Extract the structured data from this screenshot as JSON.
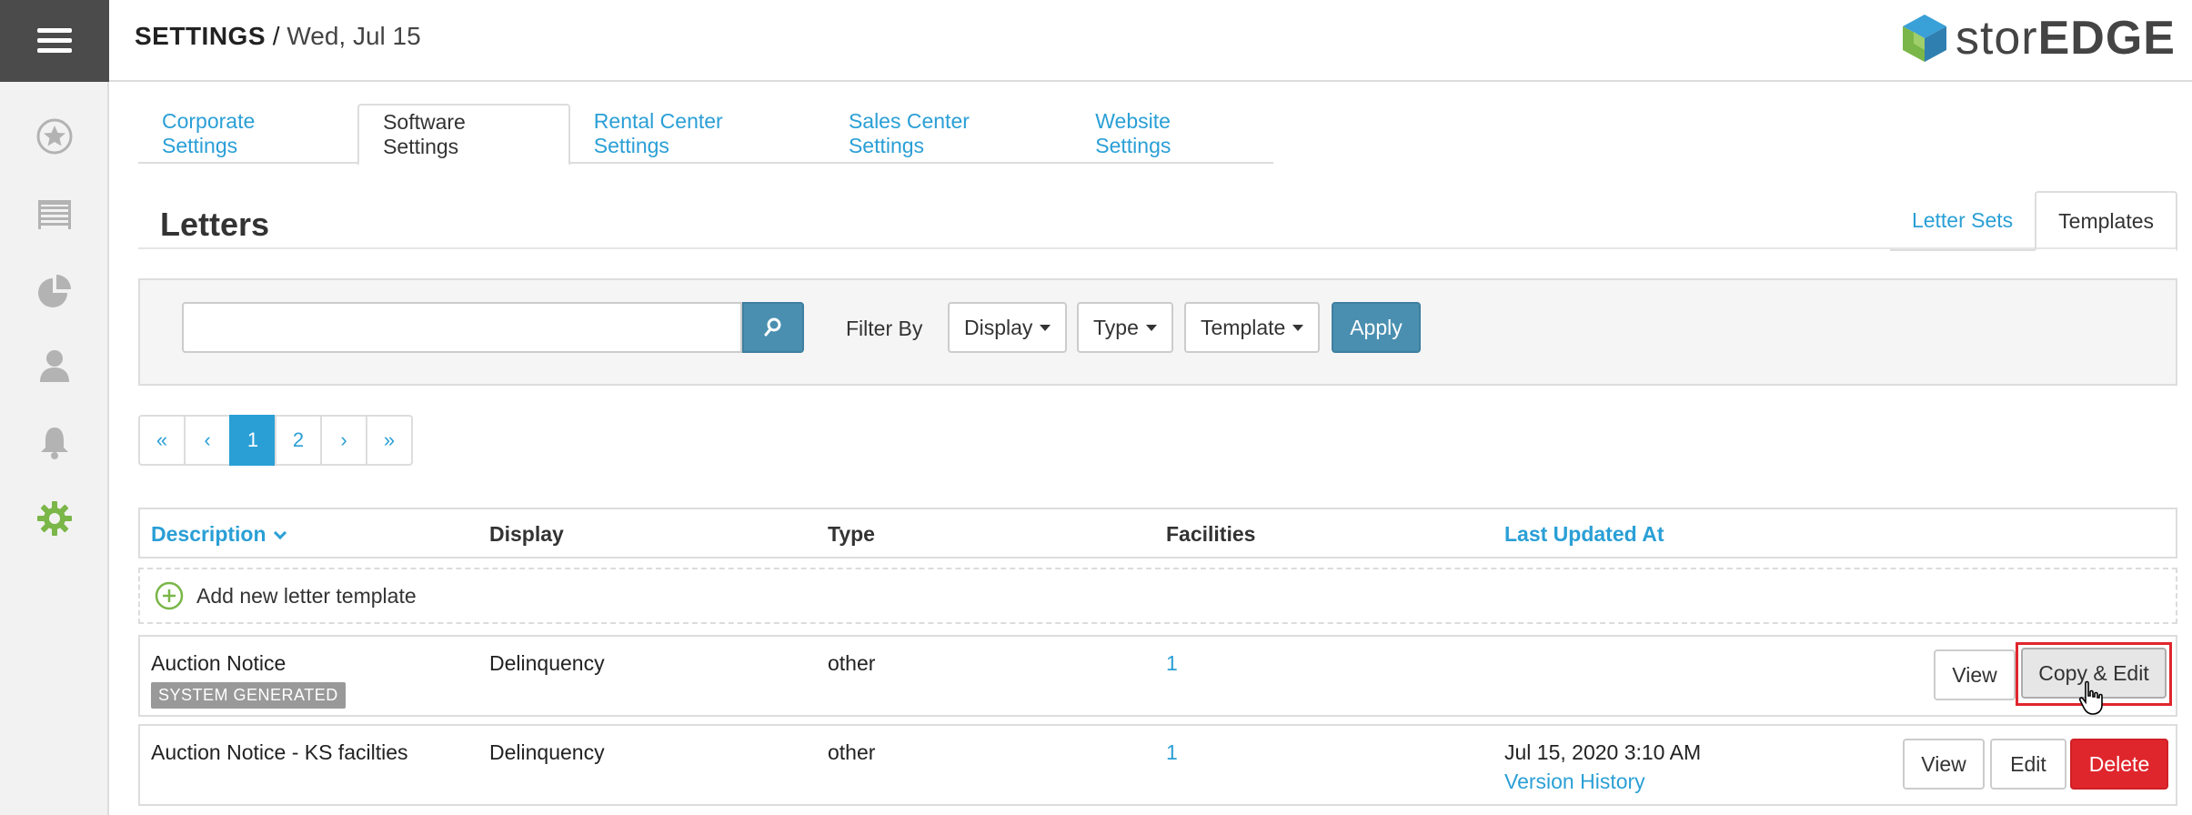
{
  "header": {
    "section": "SETTINGS",
    "separator": " / ",
    "date": "Wed, Jul 15",
    "logo_light": "stor",
    "logo_bold": "EDGE"
  },
  "rail": {
    "icons": [
      "star-icon",
      "storage-icon",
      "pie-chart-icon",
      "user-icon",
      "bell-icon",
      "gear-icon"
    ],
    "active_color": "#7ab648",
    "icon_color": "#b3b3b3"
  },
  "main_tabs": [
    {
      "label": "Corporate Settings",
      "active": false
    },
    {
      "label": "Software Settings",
      "active": true
    },
    {
      "label": "Rental Center Settings",
      "active": false
    },
    {
      "label": "Sales Center Settings",
      "active": false
    },
    {
      "label": "Website Settings",
      "active": false
    }
  ],
  "letters": {
    "title": "Letters",
    "sub_tabs": [
      {
        "label": "Letter Sets",
        "active": false
      },
      {
        "label": "Templates",
        "active": true
      }
    ]
  },
  "filter": {
    "search_value": "",
    "search_placeholder": "",
    "label": "Filter By",
    "display_label": "Display",
    "type_label": "Type",
    "template_label": "Template",
    "apply_label": "Apply"
  },
  "pagination": {
    "first": "«",
    "prev": "‹",
    "pages": [
      "1",
      "2"
    ],
    "current": "1",
    "next": "›",
    "last": "»"
  },
  "table": {
    "columns": {
      "description": "Description",
      "display": "Display",
      "type": "Type",
      "facilities": "Facilities",
      "last_updated": "Last Updated At"
    },
    "add_label": "Add new letter template",
    "rows": [
      {
        "description": "Auction Notice",
        "badge": "SYSTEM GENERATED",
        "display": "Delinquency",
        "type": "other",
        "facilities": "1",
        "last_updated": "",
        "version_history": "",
        "actions": {
          "view": "View",
          "copy_edit": "Copy & Edit"
        }
      },
      {
        "description": "Auction Notice - KS facilties",
        "badge": "",
        "display": "Delinquency",
        "type": "other",
        "facilities": "1",
        "last_updated": "Jul 15, 2020 3:10 AM",
        "version_history": "Version History",
        "actions": {
          "view": "View",
          "edit": "Edit",
          "delete": "Delete"
        }
      }
    ]
  },
  "colors": {
    "link": "#2a9fd6",
    "primary_button": "#4a8fb0",
    "danger": "#e0262d",
    "badge": "#999999",
    "add_icon": "#7ab648"
  }
}
